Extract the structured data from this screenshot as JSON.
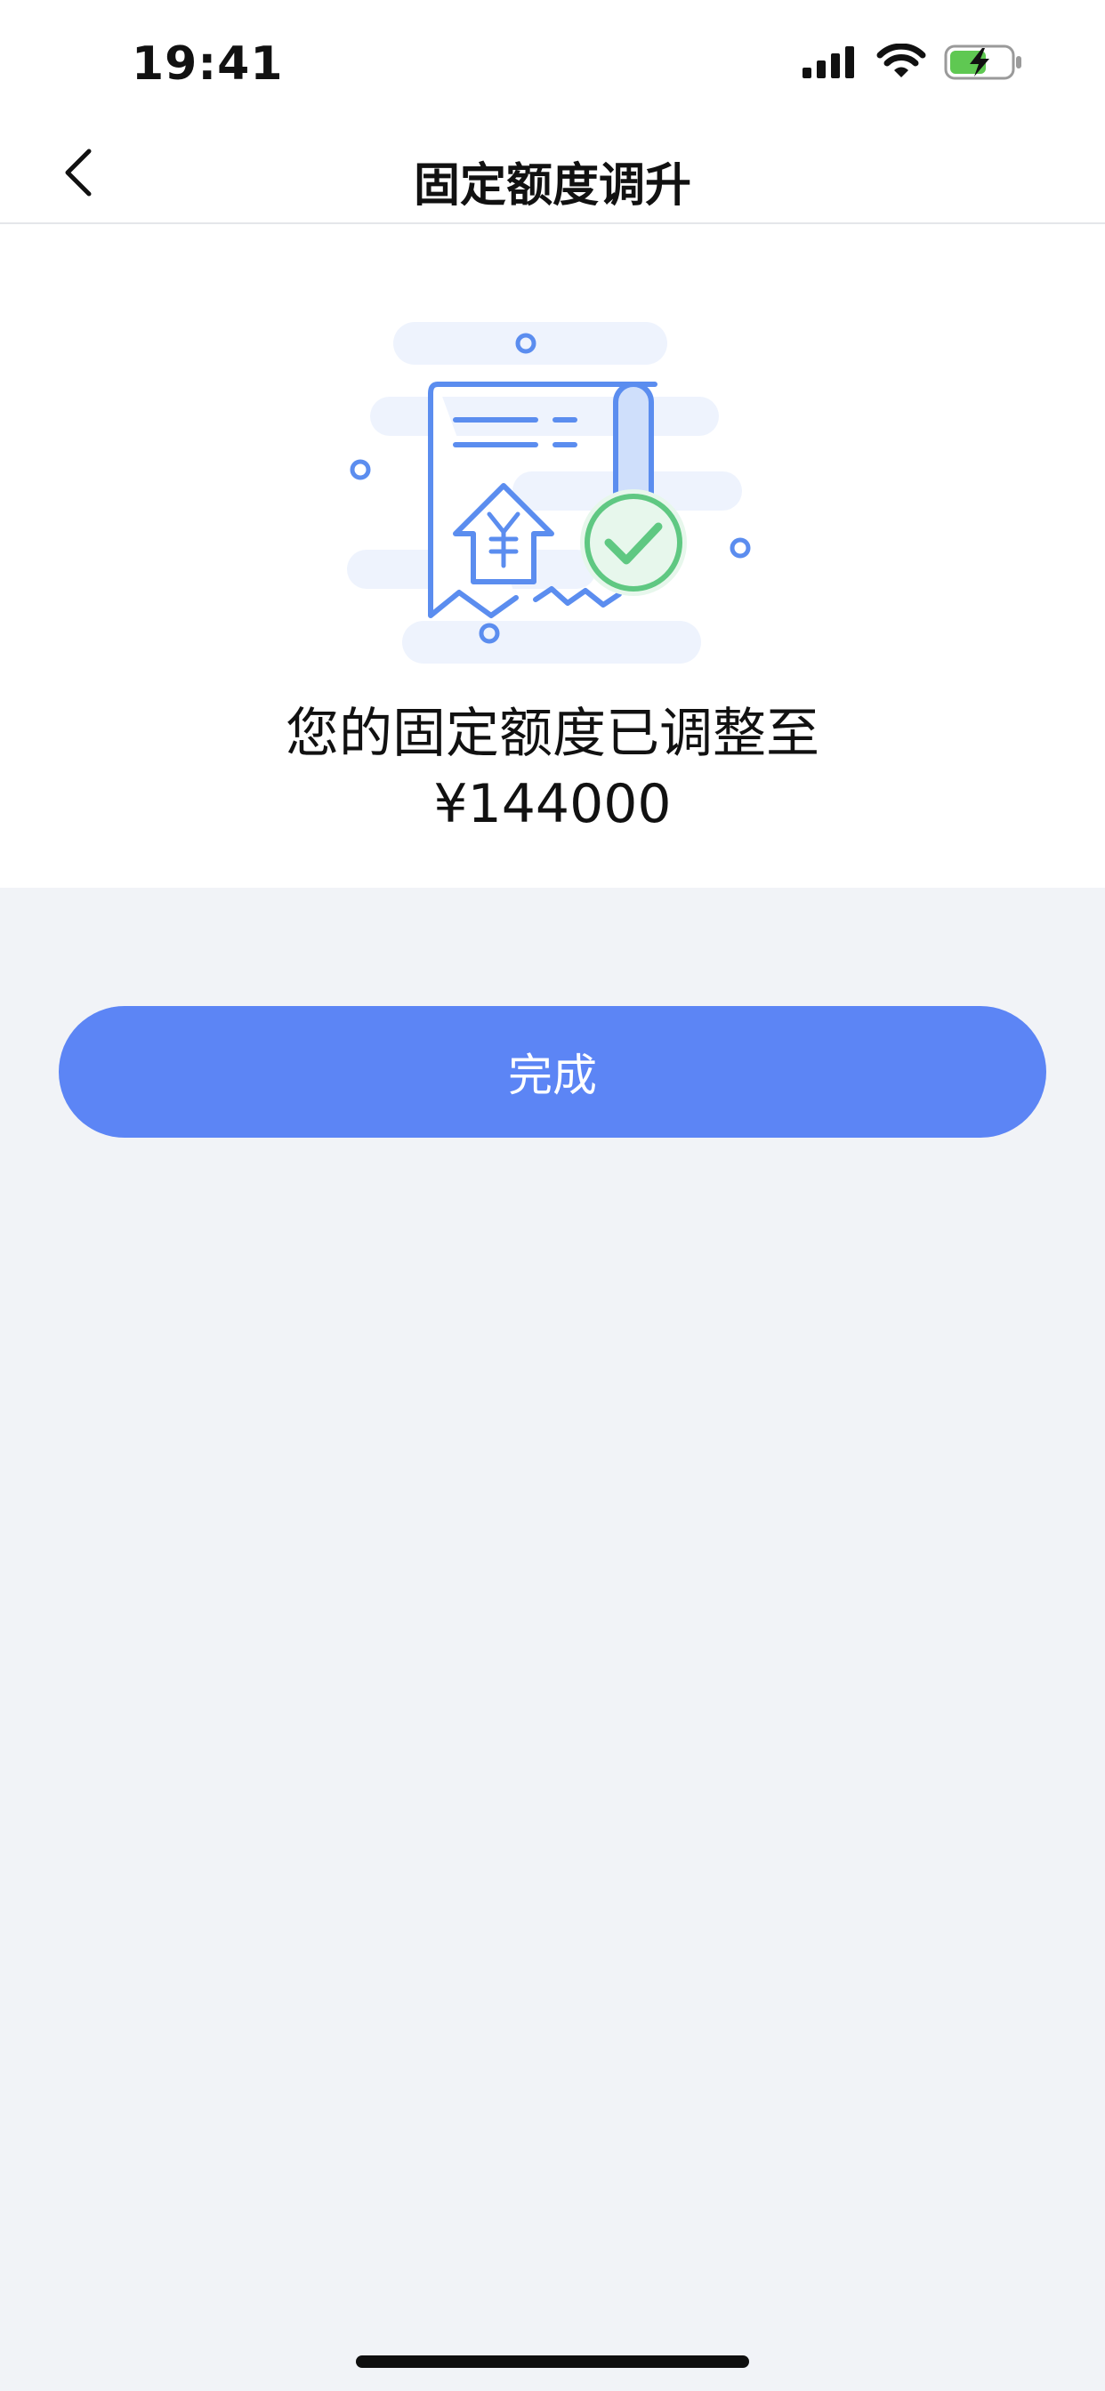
{
  "status_bar": {
    "time": "19:41",
    "icons": [
      "signal-icon",
      "wifi-icon",
      "battery-charging-icon"
    ]
  },
  "nav": {
    "title": "固定额度调升",
    "back_icon": "chevron-left-icon"
  },
  "result": {
    "illustration_icon": "receipt-upgrade-success-icon",
    "message": "您的固定额度已调整至",
    "amount": "¥144000"
  },
  "actions": {
    "done_label": "完成"
  },
  "colors": {
    "primary": "#5c85f5",
    "page_bg": "#f1f3f7",
    "success": "#5fc882",
    "text": "#111111"
  }
}
